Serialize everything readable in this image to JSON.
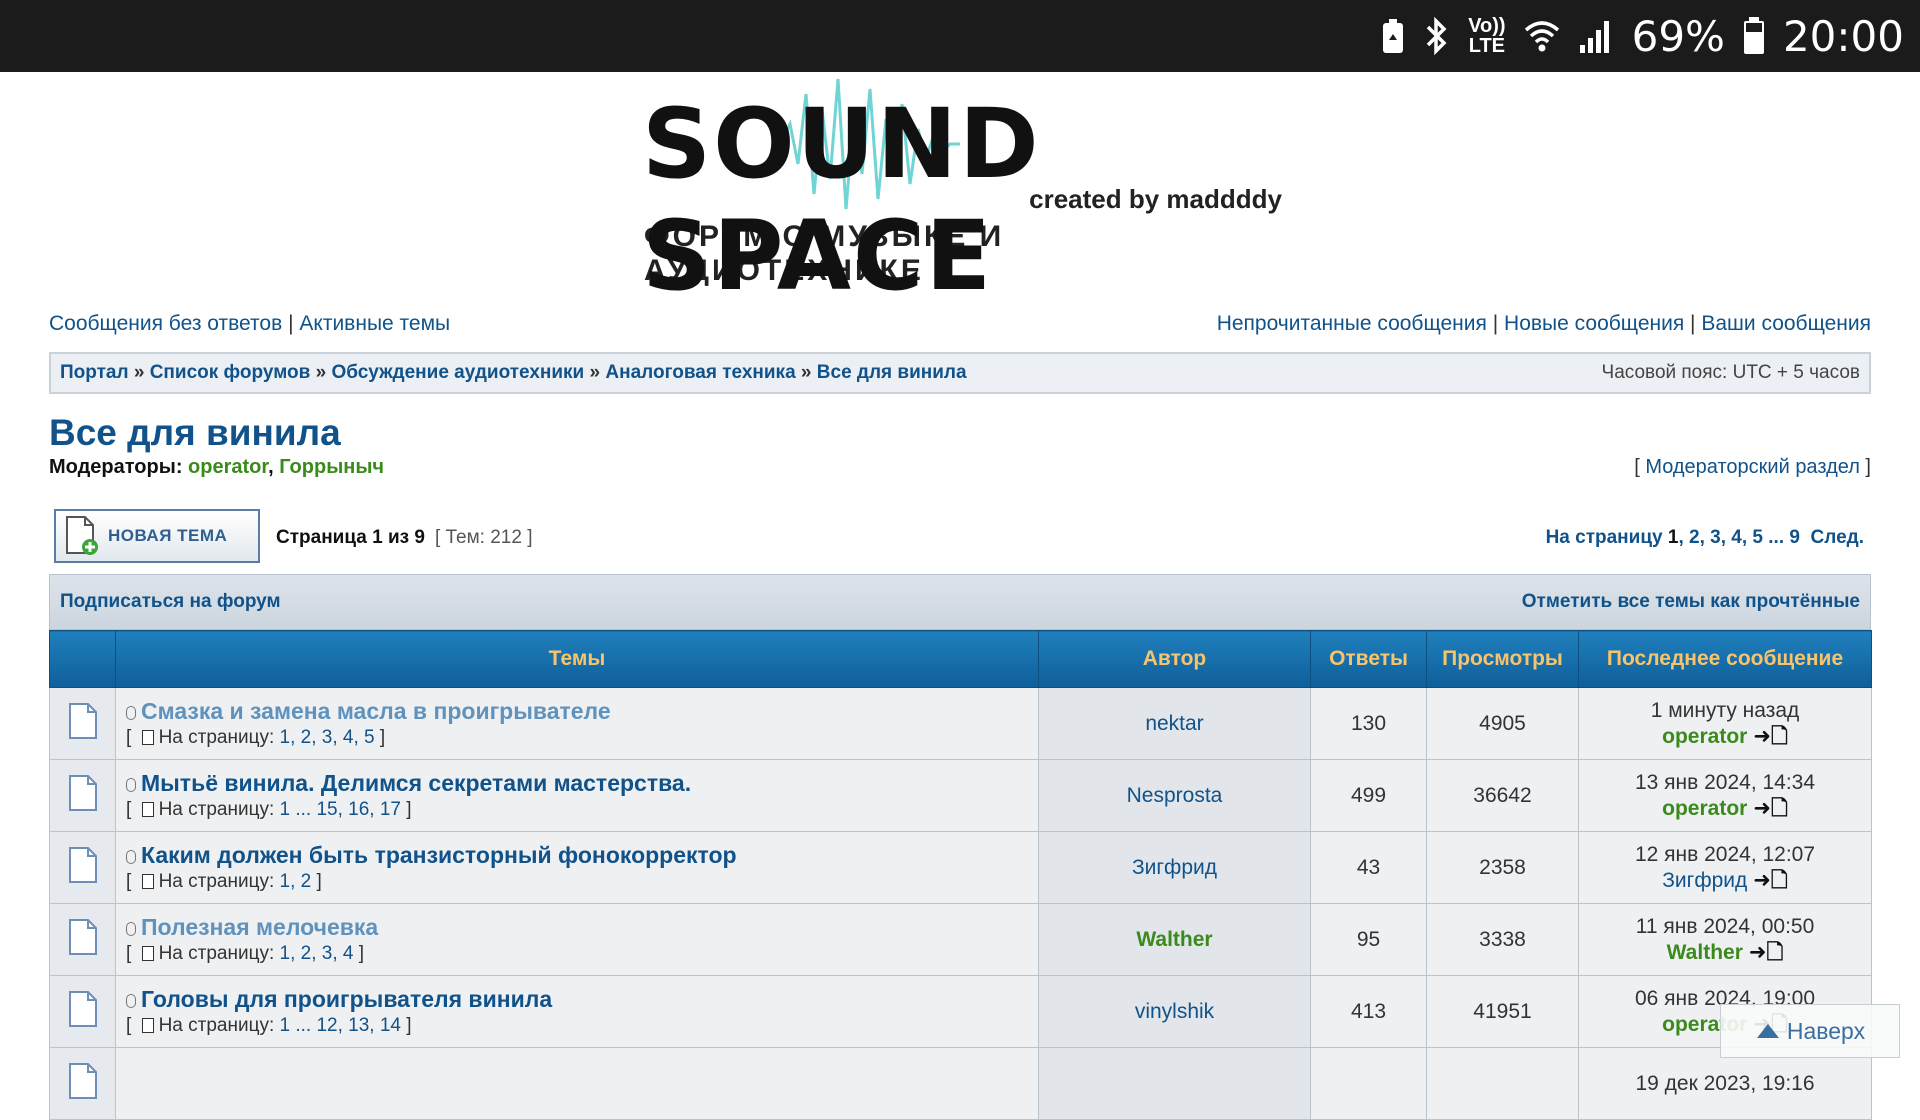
{
  "status_bar": {
    "battery": "69%",
    "time": "20:00",
    "lte_top": "Vo))",
    "lte_bottom": "LTE"
  },
  "logo": {
    "title": "SOUND SPACE",
    "subtitle": "created by maddddy",
    "tagline": "ФОРУМ О МУЗЫКЕ И АУДИОТЕХНИКЕ"
  },
  "nav": {
    "left": [
      "Сообщения без ответов",
      "Активные темы"
    ],
    "right": [
      "Непрочитанные сообщения",
      "Новые сообщения",
      "Ваши сообщения"
    ],
    "separator": "|"
  },
  "breadcrumb": {
    "items": [
      "Портал",
      "Список форумов",
      "Обсуждение аудиотехники",
      "Аналоговая техника",
      "Все для винила"
    ],
    "separator": "»",
    "timezone": "Часовой пояс: UTC + 5 часов"
  },
  "forum": {
    "title": "Все для винила",
    "moderators_label": "Модераторы:",
    "moderators": [
      "operator",
      "Горрыныч"
    ],
    "moderator_link": "Модераторский раздел"
  },
  "actions": {
    "new_topic": "НОВАЯ ТЕМА",
    "page_info": "Страница 1 из 9",
    "topic_count": "[ Тем: 212 ]",
    "pagination_label": "На страницу",
    "pages": [
      "1",
      "2",
      "3",
      "4",
      "5",
      "...",
      "9"
    ],
    "next": "След."
  },
  "subscribe": {
    "left": "Подписаться на форум",
    "right": "Отметить все темы как прочтённые"
  },
  "table": {
    "headers": {
      "topics": "Темы",
      "author": "Автор",
      "replies": "Ответы",
      "views": "Просмотры",
      "last": "Последнее сообщение"
    },
    "pages_label": "На страницу:",
    "rows": [
      {
        "title": "Смазка и замена масла в проигрывателе",
        "pages": "1, 2, 3, 4, 5",
        "author": "nektar",
        "replies": "130",
        "views": "4905",
        "last_time": "1 минуту назад",
        "last_user": "operator"
      },
      {
        "title": "Мытьё винила. Делимся секретами мастерства.",
        "pages": "1 ... 15, 16, 17",
        "author": "Nesprosta",
        "replies": "499",
        "views": "36642",
        "last_time": "13 янв 2024, 14:34",
        "last_user": "operator"
      },
      {
        "title": "Каким должен быть транзисторный фонокорректор",
        "pages": "1, 2",
        "author": "Зигфрид",
        "replies": "43",
        "views": "2358",
        "last_time": "12 янв 2024, 12:07",
        "last_user": "Зигфрид"
      },
      {
        "title": "Полезная мелочевка",
        "pages": "1, 2, 3, 4",
        "author": "Walther",
        "replies": "95",
        "views": "3338",
        "last_time": "11 янв 2024, 00:50",
        "last_user": "Walther"
      },
      {
        "title": "Головы для проигрывателя винила",
        "pages": "1 ... 12, 13, 14",
        "author": "vinylshik",
        "replies": "413",
        "views": "41951",
        "last_time": "06 янв 2024, 19:00",
        "last_user": "operator"
      },
      {
        "title": "",
        "pages": "",
        "author": "",
        "replies": "",
        "views": "",
        "last_time": "19 дек 2023, 19:16",
        "last_user": ""
      }
    ]
  },
  "back_to_top": "Наверх",
  "colors": {
    "link": "#105289",
    "moderator_green": "#3b8a1c",
    "header_gold": "#f7c46b",
    "header_blue": "#1f7fbd"
  }
}
